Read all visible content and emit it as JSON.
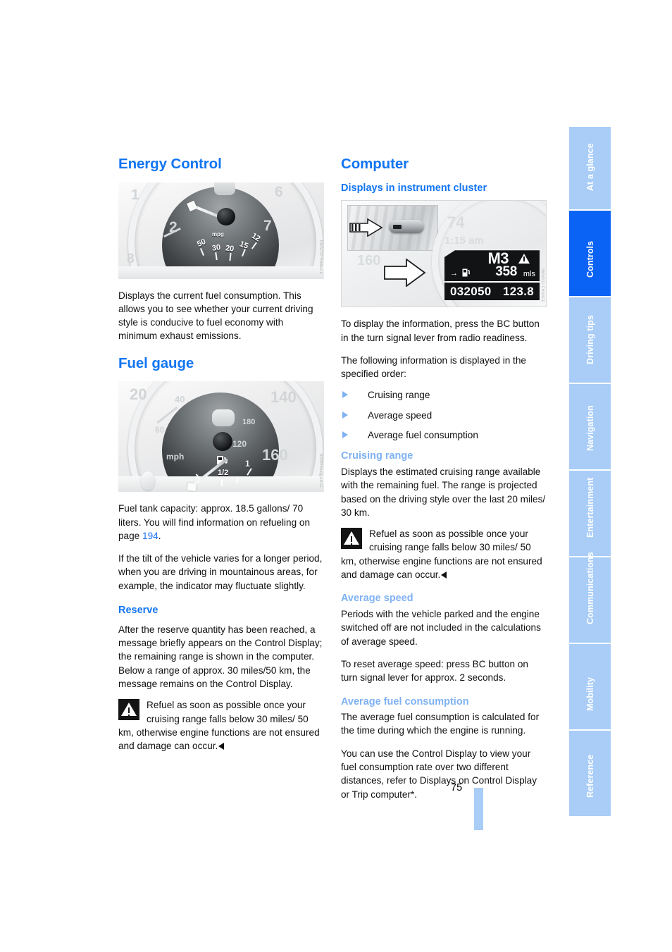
{
  "page": {
    "number": "75"
  },
  "left_column": {
    "energy_control": {
      "title": "Energy Control",
      "figure": {
        "name": "energy-control-gauge",
        "unit_label": "mpg",
        "scale_labels": [
          "50",
          "30",
          "20",
          "15",
          "12"
        ],
        "tach_ghost_labels": [
          "1",
          "2",
          "6",
          "7",
          "8"
        ],
        "credit": "BMW010 CHANGE"
      },
      "body": "Displays the current fuel consumption. This allows you to see whether your current driving style is conducive to fuel economy with minimum exhaust emissions."
    },
    "fuel_gauge": {
      "title": "Fuel gauge",
      "figure": {
        "name": "fuel-gauge",
        "half_label": "1/2",
        "full_label": "1",
        "speed_ghost_labels": [
          "20",
          "40",
          "60",
          "mph",
          "120",
          "140",
          "160",
          "180"
        ],
        "credit": "BMW010 CHANGE"
      },
      "capacity_text_before_ref": "Fuel tank capacity: approx. 18.5 gallons/ 70 liters. You will find information on refueling on page ",
      "capacity_page_ref": "194",
      "capacity_text_after_ref": ".",
      "tilt_text": "If the tilt of the vehicle varies for a longer period, when you are driving in mountainous areas, for example, the indicator may fluctuate slightly."
    },
    "reserve": {
      "title": "Reserve",
      "body": "After the reserve quantity has been reached, a message briefly appears on the Control Display; the remaining range is shown in the computer. Below a range of approx. 30 miles/50 km, the message remains on the Control Display.",
      "warning": "Refuel as soon as possible once your cruising range falls below 30 miles/ 50 km, otherwise engine functions are not ensured and damage can occur."
    }
  },
  "right_column": {
    "computer": {
      "title": "Computer"
    },
    "displays_in_cluster": {
      "title": "Displays in instrument cluster",
      "figure": {
        "name": "instrument-cluster-bc-display",
        "gear": "M3",
        "range_value": "358",
        "range_unit": "mls",
        "fuel_arrow": "→",
        "tiny_unit": "mls",
        "odometer": "032050",
        "trip": "123.8",
        "ghost_temp": "74",
        "ghost_time": "1:15 am",
        "ghost_speed": "160",
        "credit": "BMW010 CHANGE"
      },
      "intro1": "To display the information, press the BC button in the turn signal lever from radio readiness.",
      "intro2": "The following information is displayed in the specified order:",
      "items": [
        "Cruising range",
        "Average speed",
        "Average fuel consumption"
      ]
    },
    "cruising_range": {
      "title": "Cruising range",
      "body": "Displays the estimated cruising range available with the remaining fuel. The range is projected based on the driving style over the last 20 miles/ 30 km.",
      "warning": "Refuel as soon as possible once your cruising range falls below 30 miles/ 50 km, otherwise engine functions are not ensured and damage can occur."
    },
    "average_speed": {
      "title": "Average speed",
      "body1": "Periods with the vehicle parked and the engine switched off are not included in the calculations of average speed.",
      "body2": "To reset average speed: press BC button on turn signal lever for approx. 2 seconds."
    },
    "average_fuel_consumption": {
      "title": "Average fuel consumption",
      "body1": "The average fuel consumption is calculated for the time during which the engine is running.",
      "body2": "You can use the Control Display to view your fuel consumption rate over two different distances, refer to Displays on Control Display or Trip computer*."
    }
  },
  "sidebar": {
    "tabs": [
      {
        "label": "At a glance",
        "active": false
      },
      {
        "label": "Controls",
        "active": true
      },
      {
        "label": "Driving tips",
        "active": false
      },
      {
        "label": "Navigation",
        "active": false
      },
      {
        "label": "Entertainment",
        "active": false
      },
      {
        "label": "Communications",
        "active": false
      },
      {
        "label": "Mobility",
        "active": false
      },
      {
        "label": "Reference",
        "active": false
      }
    ]
  },
  "colors": {
    "heading_blue": "#1275f2",
    "minor_heading_blue": "#7fb2f3",
    "tab_blue": "#a9cdf7",
    "tab_active_blue": "#0a63f5",
    "link_blue": "#1b6ff0"
  }
}
